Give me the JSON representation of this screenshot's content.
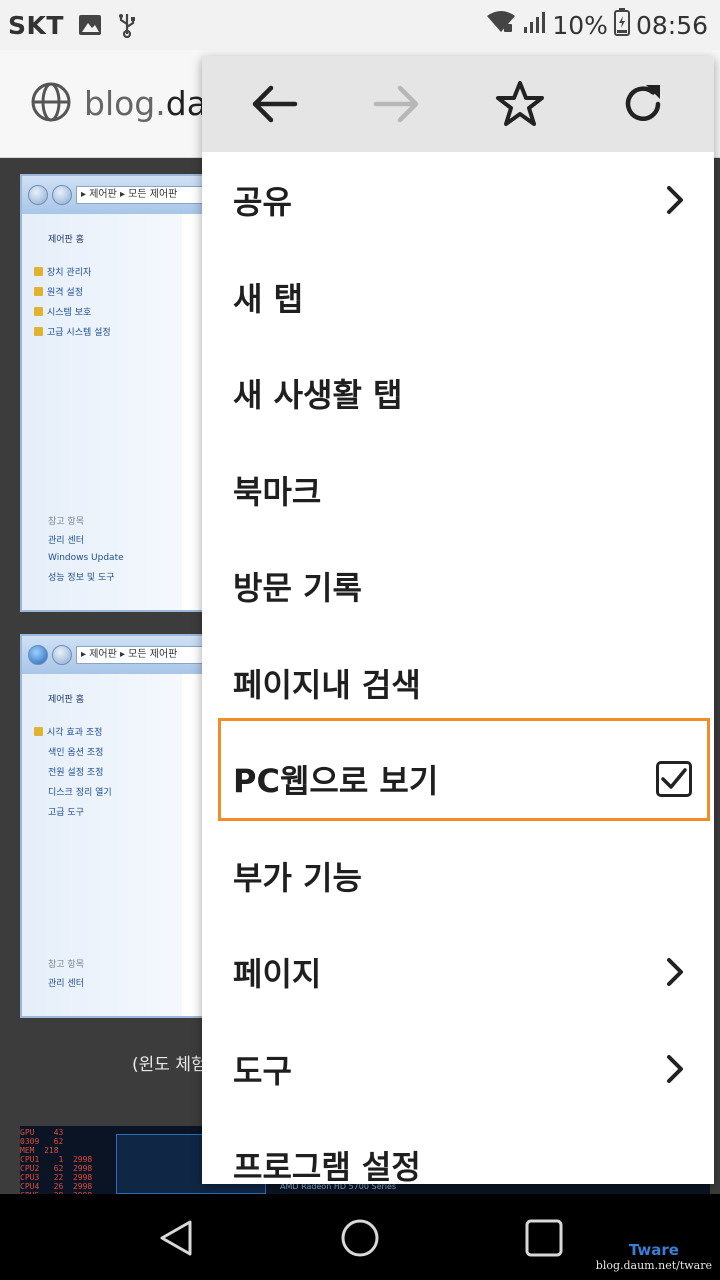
{
  "status_bar": {
    "carrier": "SKT",
    "battery": "10%",
    "time": "08:56",
    "icons": [
      "image-icon",
      "usb-icon",
      "wifi-icon",
      "signal-icon",
      "battery-icon"
    ]
  },
  "url_bar": {
    "domain_prefix": "blog.",
    "domain_visible": "dau",
    "icon": "globe-icon"
  },
  "page": {
    "shot1": {
      "address": "▸ 제어판 ▸ 모든 제어판",
      "header": "제어판 홈",
      "links": [
        "장치 관리자",
        "원격 설정",
        "시스템 보호",
        "고급 시스템 설정"
      ],
      "see_also_title": "참고 항목",
      "see_also": [
        "관리 센터",
        "Windows Update",
        "성능 정보 및 도구"
      ]
    },
    "shot2": {
      "address": "▸ 제어판 ▸ 모든 제어판",
      "header": "제어판 홈",
      "links": [
        "시각 효과 조정",
        "색인 옵션 조정",
        "전원 설정 조정",
        "디스크 정리 열기",
        "고급 도구"
      ],
      "see_also_title": "참고 항목",
      "see_also": [
        "관리 센터"
      ]
    },
    "caption": "(윈도 체험",
    "gpu_label": "AMD Radeon HD 5700 Series"
  },
  "menu": {
    "nav_icons": [
      "back-arrow-icon",
      "forward-arrow-icon",
      "bookmark-star-icon",
      "reload-icon"
    ],
    "items": [
      {
        "label": "공유",
        "submenu": true
      },
      {
        "label": "새 탭"
      },
      {
        "label": "새 사생활 탭"
      },
      {
        "label": "북마크"
      },
      {
        "label": "방문 기록"
      },
      {
        "label": "페이지내 검색"
      },
      {
        "label": "PC웹으로 보기",
        "checked": true
      },
      {
        "label": "부가 기능"
      },
      {
        "label": "페이지",
        "submenu": true
      },
      {
        "label": "도구",
        "submenu": true
      },
      {
        "label": "프로그램 설정"
      }
    ],
    "highlight_color": "#f28c28"
  },
  "nav_bar": {
    "icons": [
      "back-triangle-icon",
      "home-circle-icon",
      "recents-square-icon"
    ]
  },
  "watermark": {
    "title": "Tware",
    "url": "blog.daum.net/tware"
  }
}
